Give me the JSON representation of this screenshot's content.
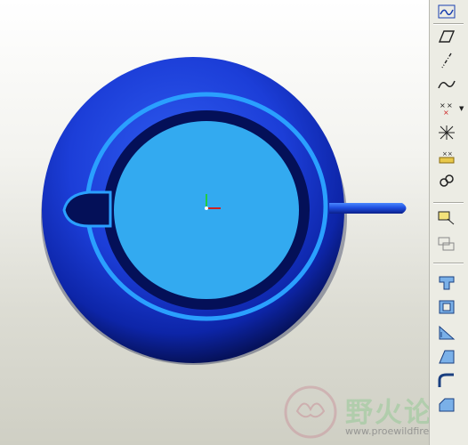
{
  "viewport": {
    "model_name": "teapot-lid-model",
    "colors": {
      "body_dark": "#0a1e8c",
      "body_light": "#2f5cf0",
      "rim_light": "#2aa0ff",
      "face": "#33aaf0",
      "groove": "#041058"
    }
  },
  "toolbar": {
    "items": [
      {
        "icon": "sketch-icon"
      },
      {
        "icon": "plane-icon"
      },
      {
        "icon": "axis-icon"
      },
      {
        "icon": "curve-icon"
      },
      {
        "icon": "datum-point-icon"
      },
      {
        "icon": "coordinate-system-icon"
      },
      {
        "icon": "analysis-icon"
      },
      {
        "icon": "extrude-chain-icon"
      },
      {
        "icon": "copy-icon"
      },
      {
        "icon": "paste-icon"
      },
      {
        "icon": "hole-icon"
      },
      {
        "icon": "shell-icon"
      },
      {
        "icon": "rib-icon"
      },
      {
        "icon": "draft-icon"
      },
      {
        "icon": "round-icon"
      },
      {
        "icon": "chamfer-icon"
      }
    ]
  },
  "watermark": {
    "title": "野火论坛",
    "url": "www.proewildfire.cn"
  }
}
